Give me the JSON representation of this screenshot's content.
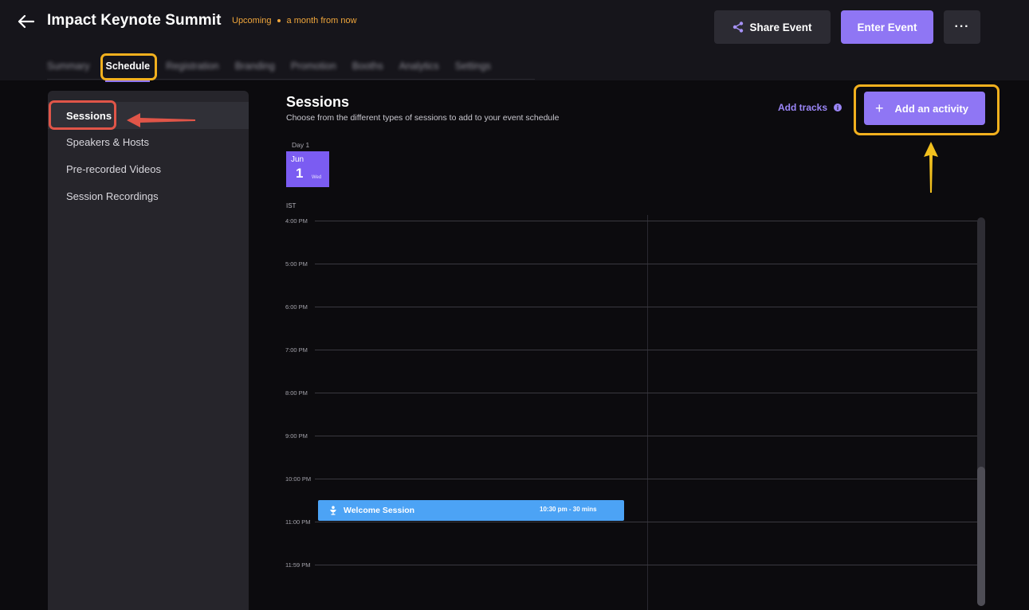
{
  "header": {
    "title": "Impact Keynote Summit",
    "status": "Upcoming",
    "relative_time": "a month from now",
    "share_label": "Share Event",
    "enter_label": "Enter Event",
    "more_label": "···"
  },
  "tabs": [
    {
      "label": "Summary"
    },
    {
      "label": "Schedule"
    },
    {
      "label": "Registration"
    },
    {
      "label": "Branding"
    },
    {
      "label": "Promotion"
    },
    {
      "label": "Booths"
    },
    {
      "label": "Analytics"
    },
    {
      "label": "Settings"
    }
  ],
  "sidebar": {
    "items": [
      {
        "label": "Sessions"
      },
      {
        "label": "Speakers & Hosts"
      },
      {
        "label": "Pre-recorded Videos"
      },
      {
        "label": "Session Recordings"
      }
    ]
  },
  "main": {
    "title": "Sessions",
    "subtitle": "Choose from the different types of sessions to add to your event schedule",
    "add_tracks": "Add tracks",
    "add_activity": "Add an activity"
  },
  "day": {
    "label": "Day 1",
    "month": "Jun",
    "date": "1",
    "weekday": "Wed"
  },
  "timezone": "IST",
  "hours": [
    "4:00 PM",
    "5:00 PM",
    "6:00 PM",
    "7:00 PM",
    "8:00 PM",
    "9:00 PM",
    "10:00 PM",
    "11:00 PM",
    "11:59 PM"
  ],
  "session": {
    "name": "Welcome Session",
    "time": "10:30 pm - 30 mins"
  },
  "colors": {
    "accent": "#8f76f4",
    "highlight_yellow": "#f2b01e",
    "highlight_red": "#e05548",
    "session_blue": "#4ca3f5",
    "status_orange": "#f0a63b"
  }
}
